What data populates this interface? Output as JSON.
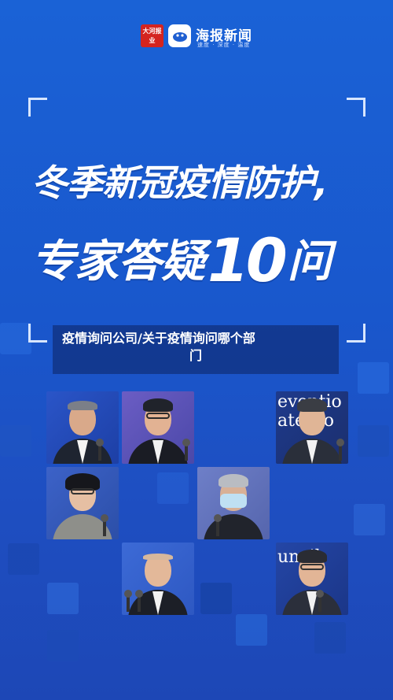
{
  "header": {
    "dahe_logo_text": "大河报业",
    "brand_name": "海报新闻",
    "brand_tagline": "速度 · 深度 · 温度"
  },
  "poster": {
    "headline_line1": "冬季新冠疫情防护,",
    "headline_line2_prefix": "专家答疑",
    "headline_line2_number": "10",
    "headline_line2_suffix": "问"
  },
  "article": {
    "title_line1": "疫情询问公司/关于疫情询问哪个部",
    "title_line2": "门"
  },
  "experts": [
    {
      "name": "expert-1",
      "sign_text": ""
    },
    {
      "name": "expert-2",
      "sign_text": ""
    },
    {
      "name": "expert-3",
      "sign_text": "eventio\nate Co"
    },
    {
      "name": "expert-4",
      "sign_text": ""
    },
    {
      "name": "expert-5",
      "sign_text": ""
    },
    {
      "name": "expert-6",
      "sign_text": ""
    },
    {
      "name": "expert-7",
      "sign_text": "uncil"
    }
  ],
  "colors": {
    "background": "#1a56c8",
    "overlay": "#0f286e",
    "brand_red": "#d4241f"
  }
}
